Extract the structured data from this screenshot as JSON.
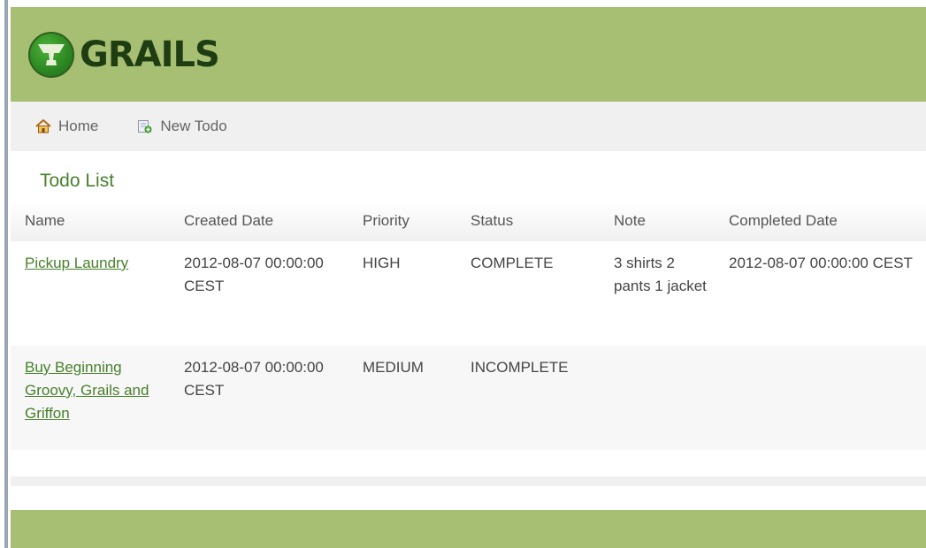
{
  "brand": {
    "logo_text": "GRAILS"
  },
  "nav": {
    "items": [
      {
        "label": "Home",
        "icon": "home-icon"
      },
      {
        "label": "New Todo",
        "icon": "new-document-icon"
      }
    ]
  },
  "page": {
    "title": "Todo List"
  },
  "table": {
    "headers": [
      "Name",
      "Created Date",
      "Priority",
      "Status",
      "Note",
      "Completed Date"
    ],
    "rows": [
      {
        "name": "Pickup Laundry",
        "created": "2012-08-07 00:00:00 CEST",
        "priority": "HIGH",
        "status": "COMPLETE",
        "note": "3 shirts 2 pants 1 jacket",
        "completed": "2012-08-07 00:00:00 CEST"
      },
      {
        "name": "Buy Beginning Groovy, Grails and Griffon",
        "created": "2012-08-07 00:00:00 CEST",
        "priority": "MEDIUM",
        "status": "INCOMPLETE",
        "note": "",
        "completed": ""
      }
    ]
  },
  "colors": {
    "header_green": "#a7bf72",
    "title_green": "#48802c",
    "nav_bg": "#f0f0f0"
  }
}
